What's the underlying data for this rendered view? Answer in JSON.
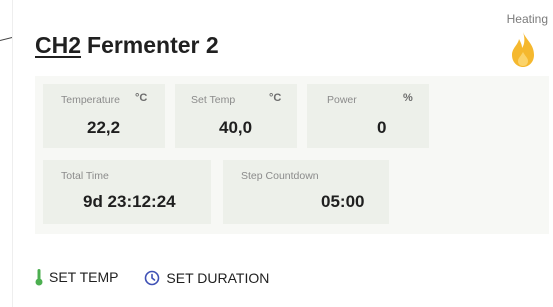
{
  "card": {
    "channel": "CH2",
    "name": "Fermenter 2",
    "status": "Heating"
  },
  "tiles": {
    "temperature": {
      "label": "Temperature",
      "unit": "°C",
      "value": "22,2"
    },
    "set_temp": {
      "label": "Set Temp",
      "unit": "°C",
      "value": "40,0"
    },
    "power": {
      "label": "Power",
      "unit": "%",
      "value": "0"
    },
    "total_time": {
      "label": "Total Time",
      "value": "9d 23:12:24"
    },
    "step_countdown": {
      "label": "Step Countdown",
      "value": "05:00"
    }
  },
  "actions": {
    "set_temp": "SET TEMP",
    "set_duration": "SET DURATION"
  },
  "colors": {
    "flame": "#f5b82e",
    "thermometer": "#4caf50",
    "clock": "#3f51b5",
    "tile_bg": "#edf0ea"
  },
  "icons": [
    "flame-icon",
    "thermometer-icon",
    "clock-icon"
  ]
}
